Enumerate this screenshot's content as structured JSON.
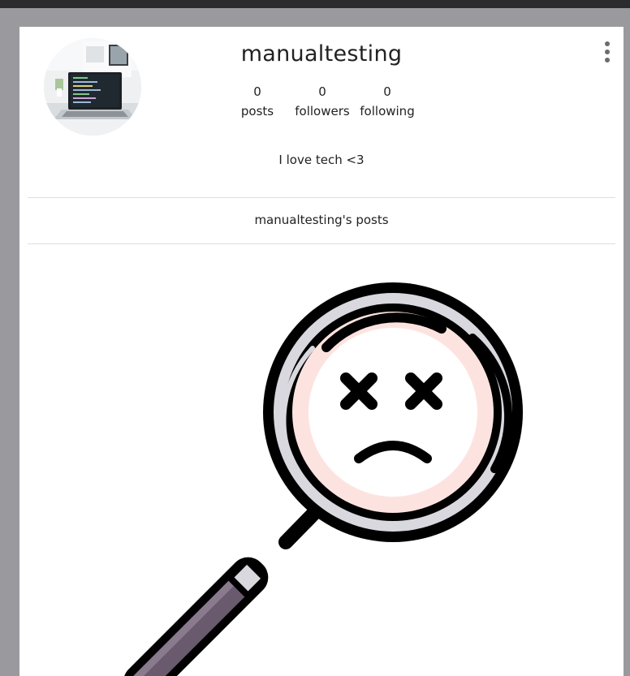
{
  "profile": {
    "username": "manualtesting",
    "avatar_alt": "laptop on desk",
    "stats": [
      {
        "value": "0",
        "label": "posts"
      },
      {
        "value": "0",
        "label": "followers"
      },
      {
        "value": "0",
        "label": "following"
      }
    ],
    "bio": "I love tech <3"
  },
  "posts_section": {
    "title": "manualtesting's posts",
    "empty_state_icon": "magnifier-sad-face-icon"
  },
  "colors": {
    "page_bg": "#9a9a9e",
    "topbar": "#2c2c2e",
    "card_bg": "#ffffff",
    "lens_ring": "#d9d8de",
    "lens_face": "#fde3df",
    "handle": "#6a5a6e"
  }
}
